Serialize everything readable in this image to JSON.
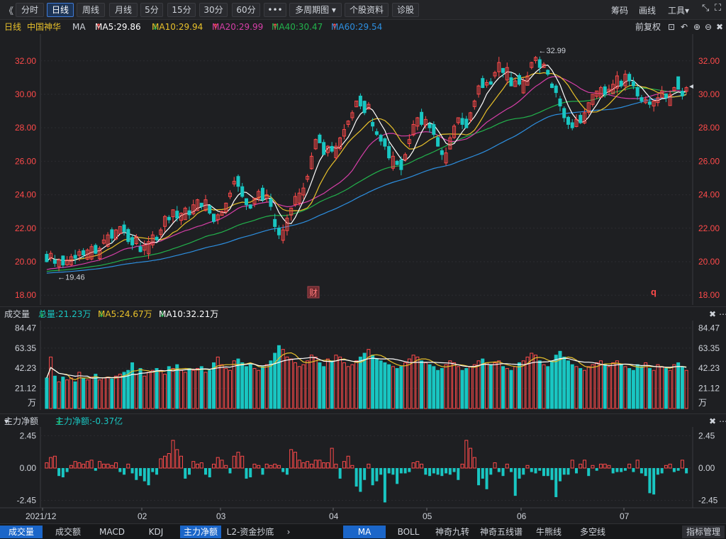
{
  "toolbar": {
    "back_icon": "double-chevron-left-icon",
    "tabs": [
      "分时",
      "日线",
      "周线",
      "月线",
      "5分",
      "15分",
      "30分",
      "60分"
    ],
    "active_tab": "日线",
    "more_label": "•••",
    "period_select": "多周期图",
    "stock_info": "个股资料",
    "diagnose": "诊股",
    "right": {
      "chips": "筹码",
      "draw": "画线",
      "tools": "工具"
    },
    "shrink_icon": "shrink-icon",
    "fullscreen_icon": "fullscreen-icon"
  },
  "ma_bar": {
    "period": "日线",
    "stock": "中国神华",
    "ma_label": "MA",
    "ma5": "MA5:29.86",
    "ma10": "MA10:29.94",
    "ma20": "MA20:29.99",
    "ma40": "MA40:30.47",
    "ma60": "MA60:29.54",
    "adjust": "前复权",
    "colors": {
      "ma5": "#ffffff",
      "ma10": "#e8c12b",
      "ma20": "#d63fa8",
      "ma40": "#22b24c",
      "ma60": "#2d8fe0",
      "up": "#ff4a4a",
      "down": "#19c6c2"
    }
  },
  "volume_hdr": {
    "label": "成交量",
    "total": "总量:21.23万",
    "ma5": "MA5:24.67万",
    "ma10": "MA10:32.21万"
  },
  "flow_hdr": {
    "label": "主力净额",
    "value": "主力净额:-0.37亿"
  },
  "chart_data": [
    {
      "type": "candlestick",
      "title": "中国神华 日线",
      "ylim": [
        17.5,
        33.6
      ],
      "y_ticks": [
        "32.00",
        "30.00",
        "28.00",
        "26.00",
        "24.00",
        "22.00",
        "20.00",
        "18.00"
      ],
      "x_ticks": [
        "2021/12",
        "02",
        "03",
        "04",
        "05",
        "06",
        "07"
      ],
      "annotations": {
        "high": "32.99",
        "low": "19.46",
        "event1": "财",
        "event2": "q"
      },
      "close": [
        20.0,
        20.5,
        19.9,
        20.1,
        19.8,
        20.1,
        20.3,
        20.2,
        20.6,
        20.4,
        20.7,
        20.9,
        20.5,
        20.8,
        21.3,
        21.6,
        21.4,
        21.9,
        22.1,
        21.8,
        21.2,
        21.0,
        21.5,
        20.6,
        21.0,
        21.2,
        21.6,
        21.3,
        21.9,
        22.7,
        22.5,
        23.1,
        22.6,
        22.9,
        23.2,
        22.8,
        23.4,
        23.7,
        23.3,
        23.7,
        22.9,
        22.4,
        22.8,
        23.0,
        23.5,
        24.1,
        24.8,
        24.5,
        23.9,
        23.4,
        23.2,
        23.8,
        24.2,
        23.7,
        24.0,
        23.3,
        22.1,
        21.6,
        21.9,
        22.6,
        23.2,
        23.9,
        24.1,
        24.4,
        25.1,
        26.3,
        27.3,
        27.1,
        26.4,
        26.9,
        26.6,
        26.9,
        27.4,
        27.9,
        28.4,
        28.9,
        29.6,
        29.3,
        28.9,
        29.4,
        28.1,
        27.6,
        27.2,
        26.9,
        26.2,
        26.3,
        25.8,
        25.5,
        26.4,
        27.3,
        28.2,
        28.6,
        28.2,
        28.5,
        28.0,
        27.6,
        26.9,
        26.4,
        26.5,
        27.4,
        28.1,
        28.6,
        28.2,
        28.0,
        28.9,
        29.6,
        30.5,
        30.4,
        30.7,
        30.6,
        31.3,
        31.9,
        31.3,
        31.6,
        30.5,
        30.8,
        30.6,
        30.8,
        31.1,
        31.9,
        32.2,
        31.6,
        31.8,
        31.2,
        30.4,
        30.1,
        29.3,
        28.6,
        28.2,
        28.0,
        28.5,
        28.3,
        28.9,
        29.5,
        30.0,
        30.2,
        30.4,
        30.0,
        30.3,
        30.6,
        31.1,
        30.5,
        31.2,
        30.8,
        30.5,
        29.9,
        29.6,
        29.7,
        29.4,
        29.6,
        29.8,
        30.2,
        29.8,
        30.0,
        30.4,
        30.3,
        29.9,
        30.4
      ],
      "ma5_last": 29.86,
      "ma10_last": 29.94,
      "ma20_last": 29.99,
      "ma40_last": 30.47,
      "ma60_last": 29.54
    },
    {
      "type": "bar",
      "title": "成交量",
      "unit": "万",
      "ylim": [
        0,
        90
      ],
      "y_ticks": [
        "84.47",
        "63.35",
        "42.23",
        "21.12",
        "万"
      ],
      "values": [
        32,
        54,
        34,
        28,
        33,
        30,
        32,
        28,
        38,
        32,
        30,
        33,
        36,
        30,
        32,
        33,
        31,
        34,
        36,
        38,
        40,
        48,
        36,
        42,
        34,
        38,
        40,
        42,
        40,
        36,
        44,
        42,
        46,
        40,
        38,
        42,
        40,
        42,
        44,
        38,
        40,
        48,
        54,
        46,
        42,
        40,
        50,
        52,
        48,
        44,
        46,
        42,
        40,
        44,
        46,
        50,
        58,
        66,
        62,
        54,
        52,
        48,
        44,
        46,
        50,
        56,
        54,
        48,
        44,
        52,
        50,
        56,
        54,
        48,
        44,
        46,
        50,
        54,
        58,
        62,
        56,
        52,
        50,
        48,
        46,
        44,
        42,
        44,
        48,
        52,
        56,
        54,
        50,
        48,
        46,
        44,
        40,
        42,
        46,
        50,
        48,
        44,
        40,
        42,
        44,
        46,
        50,
        52,
        48,
        46,
        48,
        50,
        44,
        42,
        40,
        44,
        48,
        50,
        54,
        58,
        56,
        50,
        46,
        44,
        50,
        56,
        60,
        54,
        50,
        46,
        44,
        42,
        40,
        44,
        46,
        48,
        50,
        46,
        44,
        48,
        50,
        46,
        44,
        42,
        40,
        46,
        44,
        48,
        42,
        40,
        46,
        44,
        42,
        40,
        46,
        48,
        44,
        40,
        36,
        22
      ],
      "up": [
        false,
        true,
        false,
        true,
        false,
        true,
        true,
        false,
        true,
        false,
        true,
        true,
        false,
        true,
        true,
        true,
        false,
        true,
        true,
        false,
        false,
        false,
        true,
        false,
        true,
        true,
        true,
        false,
        true,
        true,
        false,
        true,
        false,
        true,
        true,
        false,
        true,
        true,
        false,
        true,
        false,
        false,
        true,
        true,
        true,
        true,
        true,
        false,
        false,
        false,
        false,
        true,
        true,
        false,
        true,
        false,
        false,
        false,
        true,
        true,
        true,
        true,
        true,
        true,
        true,
        true,
        true,
        false,
        false,
        true,
        false,
        true,
        true,
        true,
        true,
        true,
        true,
        false,
        false,
        true,
        false,
        false,
        false,
        false,
        false,
        true,
        false,
        false,
        true,
        true,
        true,
        true,
        false,
        true,
        false,
        false,
        false,
        false,
        true,
        true,
        true,
        true,
        false,
        false,
        true,
        true,
        true,
        false,
        true,
        false,
        true,
        true,
        false,
        true,
        false,
        true,
        false,
        true,
        true,
        true,
        true,
        false,
        true,
        false,
        false,
        false,
        false,
        false,
        false,
        false,
        true,
        false,
        true,
        true,
        true,
        true,
        true,
        false,
        true,
        true,
        true,
        false,
        true,
        false,
        false,
        false,
        false,
        true,
        false,
        true,
        true,
        true,
        false,
        true,
        true,
        false,
        false,
        true
      ],
      "ma5_last": 24.67,
      "ma10_last": 32.21
    },
    {
      "type": "bar",
      "title": "主力净额",
      "unit": "亿",
      "ylim": [
        -2.9,
        2.9
      ],
      "y_ticks": [
        "2.45",
        "0.00",
        "-2.45"
      ],
      "values": [
        0.4,
        0.8,
        0.9,
        -0.6,
        -0.7,
        -0.3,
        0.2,
        0.5,
        0.4,
        0.3,
        0.5,
        0.6,
        -0.2,
        0.5,
        0.3,
        0.3,
        0.2,
        0.4,
        -0.3,
        -0.5,
        0.3,
        -0.4,
        -0.9,
        -0.6,
        -1.0,
        -1.3,
        -0.3,
        -0.5,
        0.7,
        0.9,
        1.1,
        2.1,
        1.4,
        0.9,
        -0.8,
        -0.5,
        0.5,
        0.3,
        0.4,
        -0.5,
        -0.7,
        0.3,
        0.8,
        0.6,
        0.2,
        -0.4,
        0.9,
        1.2,
        0.9,
        -0.8,
        -0.7,
        0.3,
        0.2,
        -0.5,
        0.3,
        0.2,
        0.3,
        0.2,
        -0.3,
        -0.5,
        1.4,
        1.2,
        0.6,
        0.4,
        0.5,
        0.3,
        0.6,
        0.6,
        0.4,
        0.4,
        1.5,
        0.3,
        -0.8,
        0.5,
        0.9,
        0.2,
        -1.4,
        -1.8,
        -0.9,
        0.3,
        -1.3,
        -1.0,
        -0.5,
        -2.6,
        -0.4,
        -0.5,
        -1.2,
        -0.4,
        -0.4,
        -0.3,
        0.4,
        0.5,
        0.3,
        -0.5,
        -0.6,
        -0.4,
        -0.5,
        -0.6,
        -0.4,
        -0.5,
        -0.3,
        -0.9,
        0.3,
        2.1,
        1.5,
        0.8,
        -1.3,
        -0.8,
        -1.6,
        -0.5,
        0.4,
        -0.3,
        -0.6,
        0.3,
        -0.3,
        -2.1,
        -0.8,
        -0.5,
        0.2,
        -0.3,
        -0.4,
        -0.2,
        -0.6,
        -0.6,
        -0.9,
        -2.2,
        -1.0,
        -0.5,
        -0.5,
        0.6,
        -0.4,
        0.3,
        0.6,
        -0.6,
        0.2,
        -0.2,
        0.3,
        0.3,
        0.2,
        -0.4,
        -0.3,
        -0.3,
        -0.2,
        0.3,
        -0.3,
        0.6,
        -0.4,
        -0.6,
        -1.9,
        -2.0,
        -0.5,
        -0.4,
        0.2,
        0.3,
        -0.3,
        -0.2,
        0.6,
        -0.4,
        0.3,
        0.5,
        -0.4,
        -0.37
      ]
    }
  ],
  "bottom_tabs": {
    "left": [
      "成交量",
      "成交额",
      "MACD",
      "KDJ",
      "主力净额",
      "L2-资金抄底"
    ],
    "left_active": "成交量",
    "left_second_active": "主力净额",
    "right": [
      "MA",
      "BOLL",
      "神奇九转",
      "神奇五线谱",
      "牛熊线",
      "多空线",
      "指标管理"
    ],
    "right_active": "MA",
    "next_icon": "chevron-right-icon"
  }
}
